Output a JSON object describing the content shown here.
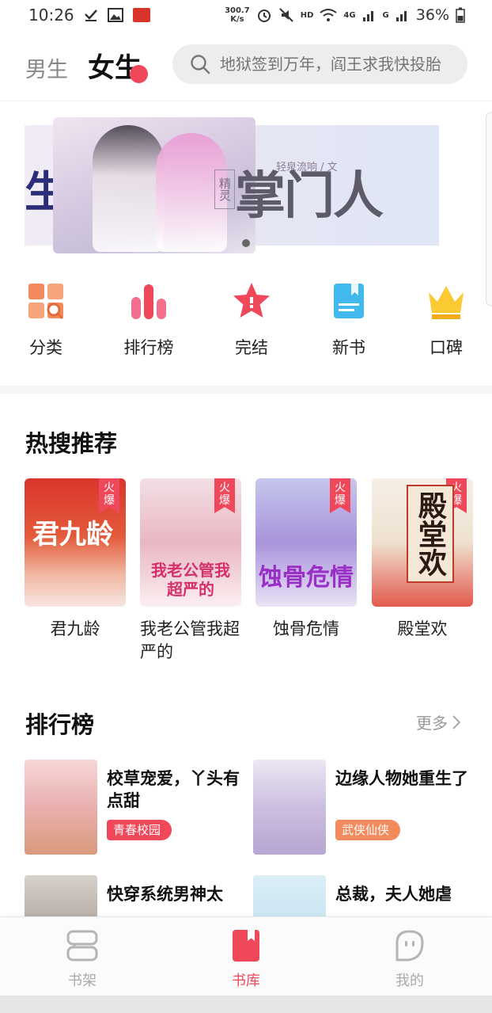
{
  "status_bar": {
    "time": "10:26",
    "net_speed_value": "300.7",
    "net_speed_unit": "K/s",
    "hd_label": "HD",
    "network_label": "4G",
    "signal_label": "G",
    "battery": "36%"
  },
  "header": {
    "tab_male": "男生",
    "tab_female": "女生",
    "search_placeholder": "地狱签到万年，阎王求我快投胎"
  },
  "banner": {
    "left_glyph": "生",
    "author": "轻泉流响 / 文",
    "tag": "精灵",
    "title": "掌门人"
  },
  "categories": [
    {
      "label": "分类",
      "icon": "category-grid-icon"
    },
    {
      "label": "排行榜",
      "icon": "ranking-bars-icon"
    },
    {
      "label": "完结",
      "icon": "finished-star-icon"
    },
    {
      "label": "新书",
      "icon": "new-book-icon"
    },
    {
      "label": "口碑",
      "icon": "crown-icon"
    }
  ],
  "hot_search": {
    "title": "热搜推荐",
    "books": [
      {
        "title": "君九龄",
        "cover_title": "君九龄",
        "badge": "火爆"
      },
      {
        "title": "我老公管我超严的",
        "cover_title": "我老公管我超严的",
        "badge": "火爆"
      },
      {
        "title": "蚀骨危情",
        "cover_title": "蚀骨危情",
        "badge": "火爆"
      },
      {
        "title": "殿堂欢",
        "cover_title": "殿堂欢",
        "badge": "火爆"
      }
    ]
  },
  "ranking": {
    "title": "排行榜",
    "more": "更多",
    "items": [
      {
        "title": "校草宠爱，丫头有点甜",
        "tag": "青春校园"
      },
      {
        "title": "边缘人物她重生了",
        "tag": "武侠仙侠"
      },
      {
        "title": "快穿系统男神太",
        "tag": ""
      },
      {
        "title": "总裁，夫人她虐",
        "tag": ""
      }
    ]
  },
  "bottom_nav": {
    "items": [
      {
        "label": "书架",
        "icon": "bookshelf-icon"
      },
      {
        "label": "书库",
        "icon": "library-icon"
      },
      {
        "label": "我的",
        "icon": "profile-icon"
      }
    ]
  },
  "colors": {
    "accent": "#f0485b",
    "tag_orange": "#f38a5d",
    "tag_pink": "#f0485b"
  }
}
